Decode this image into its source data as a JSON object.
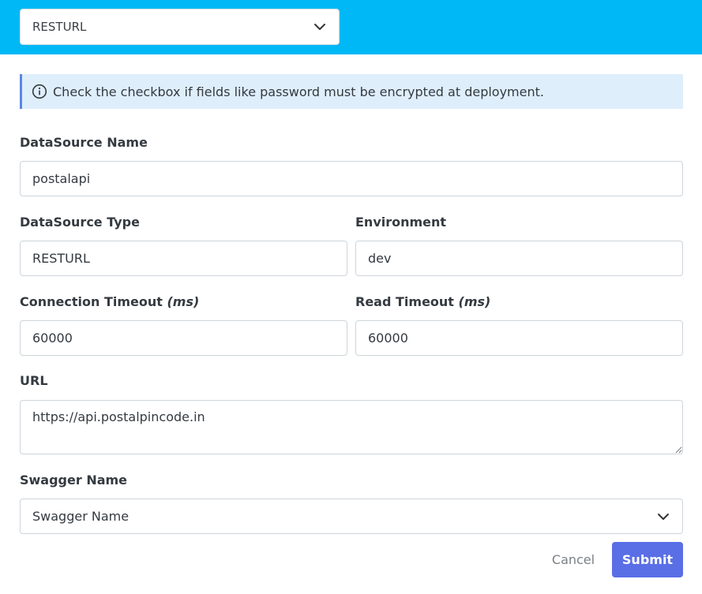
{
  "header": {
    "type_select_value": "RESTURL"
  },
  "info_banner": {
    "text": "Check the checkbox if fields like password must be encrypted at deployment."
  },
  "form": {
    "datasource_name": {
      "label": "DataSource Name",
      "value": "postalapi"
    },
    "datasource_type": {
      "label": "DataSource Type",
      "value": "RESTURL"
    },
    "environment": {
      "label": "Environment",
      "value": "dev"
    },
    "connection_timeout": {
      "label": "Connection Timeout",
      "unit": "(ms)",
      "value": "60000"
    },
    "read_timeout": {
      "label": "Read Timeout",
      "unit": "(ms)",
      "value": "60000"
    },
    "url": {
      "label": "URL",
      "value": "https://api.postalpincode.in"
    },
    "swagger_name": {
      "label": "Swagger Name",
      "value": "Swagger Name"
    }
  },
  "actions": {
    "cancel_label": "Cancel",
    "submit_label": "Submit"
  },
  "colors": {
    "header_bg": "#00b8f5",
    "info_bg": "#dfeefb",
    "info_border": "#5b86e5",
    "submit_bg": "#5a6ee6"
  },
  "icons": {
    "info": "info-circle-icon",
    "chevron": "chevron-down-icon"
  }
}
